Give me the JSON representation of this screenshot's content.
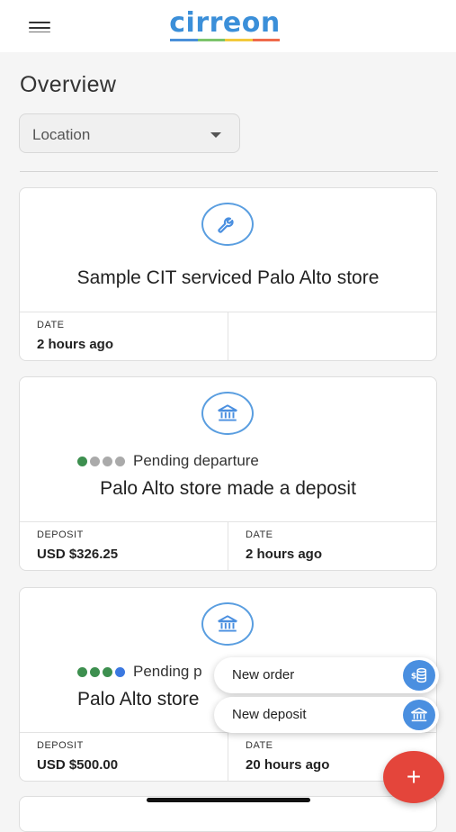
{
  "app": {
    "logo_text": "cirreon",
    "logo_colors": [
      "#4a90d9",
      "#7cc46b",
      "#f3c93b",
      "#ef6a4b"
    ]
  },
  "page": {
    "title": "Overview"
  },
  "filter": {
    "location_label": "Location"
  },
  "cards": [
    {
      "icon": "wrench-icon",
      "title": "Sample CIT serviced Palo Alto store",
      "fields": [
        {
          "label": "DATE",
          "value": "2 hours ago"
        },
        {
          "label": "",
          "value": ""
        }
      ]
    },
    {
      "icon": "bank-icon",
      "status_label": "Pending departure",
      "status_dots": [
        "#3d8f4f",
        "#aaaaaa",
        "#aaaaaa",
        "#aaaaaa"
      ],
      "title": "Palo Alto store made a deposit",
      "fields": [
        {
          "label": "DEPOSIT",
          "value": "USD $326.25"
        },
        {
          "label": "DATE",
          "value": "2 hours ago"
        }
      ]
    },
    {
      "icon": "bank-icon",
      "status_label": "Pending p",
      "status_dots": [
        "#3d8f4f",
        "#3d8f4f",
        "#3d8f4f",
        "#3b78e0"
      ],
      "title": "Palo Alto store",
      "fields": [
        {
          "label": "DEPOSIT",
          "value": "USD $500.00"
        },
        {
          "label": "DATE",
          "value": "20 hours ago"
        }
      ]
    }
  ],
  "fab_menu": {
    "new_order_label": "New order",
    "new_deposit_label": "New deposit",
    "plus": "+"
  },
  "colors": {
    "accent": "#4a8fe0",
    "fab": "#e4453b",
    "pending_complete": "#3d8f4f",
    "pending_current": "#3b78e0",
    "pending_inactive": "#aaaaaa"
  }
}
